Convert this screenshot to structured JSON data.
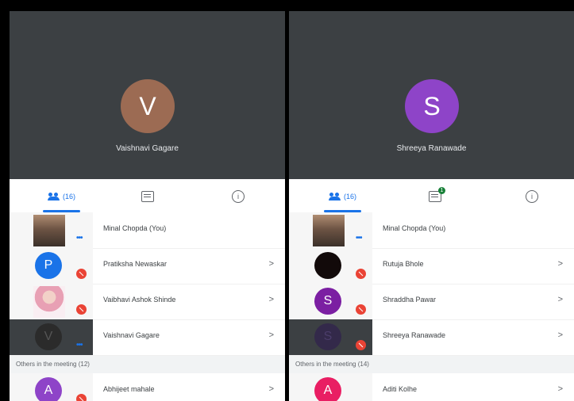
{
  "panels": [
    {
      "video_initial": "V",
      "video_name": "Vaishnavi Gagare",
      "tabs": {
        "people_count": "(16)",
        "chat_badge": ""
      },
      "participants": [
        {
          "name": "Minal Chopda (You)",
          "initial": "",
          "kind": "photo"
        },
        {
          "name": "Pratiksha Newaskar",
          "initial": "P",
          "kind": "initial",
          "color": "#1a73e8"
        },
        {
          "name": "Vaibhavi Ashok Shinde",
          "initial": "",
          "kind": "pink"
        },
        {
          "name": "Vaishnavi Gagare",
          "initial": "V",
          "kind": "dark"
        }
      ],
      "others_label": "Others in the meeting (12)",
      "others": [
        {
          "name": "Abhijeet mahale",
          "initial": "A",
          "color": "#8e44c8"
        }
      ]
    },
    {
      "video_initial": "S",
      "video_name": "Shreeya Ranawade",
      "tabs": {
        "people_count": "(16)",
        "chat_badge": "1"
      },
      "participants": [
        {
          "name": "Minal Chopda (You)",
          "initial": "",
          "kind": "photo"
        },
        {
          "name": "Rutuja Bhole",
          "initial": "",
          "kind": "black"
        },
        {
          "name": "Shraddha Pawar",
          "initial": "S",
          "kind": "initial",
          "color": "#7b1fa2"
        },
        {
          "name": "Shreeya Ranawade",
          "initial": "S",
          "kind": "dark"
        }
      ],
      "others_label": "Others in the meeting (14)",
      "others": [
        {
          "name": "Aditi Kolhe",
          "initial": "A",
          "color": "#e91e63"
        }
      ]
    }
  ],
  "icons": {
    "people": "people-icon",
    "chat": "chat-icon",
    "info": "info-icon",
    "more": "more-dots-icon",
    "mic_off": "mic-off-icon",
    "chevron": "chevron-right-icon"
  },
  "colors": {
    "accent": "#1a73e8",
    "video_bg": "#3c4043"
  }
}
